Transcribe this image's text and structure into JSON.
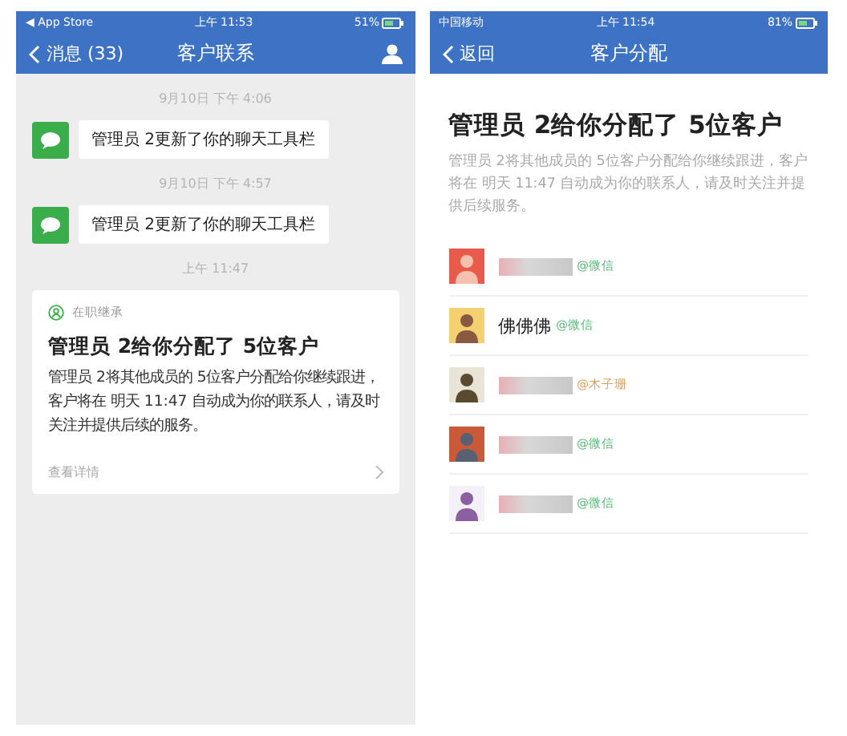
{
  "left_phone": {
    "status_bar": {
      "carrier": "◀ App Store",
      "time": "上午 11:53",
      "battery": "51%"
    },
    "nav": {
      "back": "消息 (33)",
      "title": "客户联系"
    },
    "messages": [
      {
        "time": "9月10日 下午 4:06",
        "text": "管理员 2更新了你的聊天工具栏"
      },
      {
        "time": "9月10日 下午 4:57",
        "text": "管理员 2更新了你的聊天工具栏"
      }
    ],
    "card": {
      "time": "上午 11:47",
      "tag": "在职继承",
      "title": "管理员 2给你分配了 5位客户",
      "body": "管理员 2将其他成员的 5位客户分配给你继续跟进，客户将在 明天 11:47 自动成为你的联系人，请及时关注并提供后续的服务。",
      "link": "查看详情"
    }
  },
  "right_phone": {
    "status_bar": {
      "carrier": "中国移动",
      "time": "上午 11:54",
      "battery": "81%"
    },
    "nav": {
      "back": "返回",
      "title": "客户分配"
    },
    "title": "管理员 2给你分配了 5位客户",
    "description": "管理员 2将其他成员的 5位客户分配给你继续跟进，客户将在 明天 11:47 自动成为你的联系人，请及时关注并提供后续服务。",
    "customers": [
      {
        "redacted": true,
        "source": "@微信",
        "color": "#5cb87a"
      },
      {
        "redacted": false,
        "name": "佛佛佛",
        "source": "@微信",
        "color": "#5cb87a"
      },
      {
        "redacted": true,
        "source": "@木子珊",
        "color": "#e0a060"
      },
      {
        "redacted": true,
        "source": "@微信",
        "color": "#5cb87a"
      },
      {
        "redacted": true,
        "source": "@微信",
        "color": "#5cb87a"
      }
    ]
  }
}
